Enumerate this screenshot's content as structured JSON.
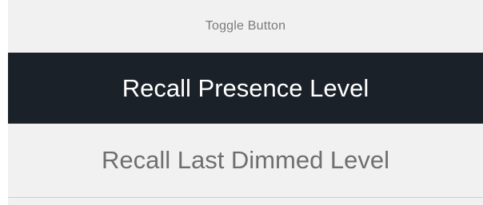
{
  "header": {
    "title": "Toggle Button"
  },
  "toggle": {
    "options": [
      {
        "label": "Recall Presence Level",
        "selected": true
      },
      {
        "label": "Recall Last Dimmed Level",
        "selected": false
      }
    ]
  },
  "colors": {
    "selected_background": "#1b2128",
    "selected_text": "#ffffff",
    "unselected_background": "#f1f1f1",
    "unselected_text": "#6f6f6f",
    "header_text": "#7b7b7b"
  }
}
